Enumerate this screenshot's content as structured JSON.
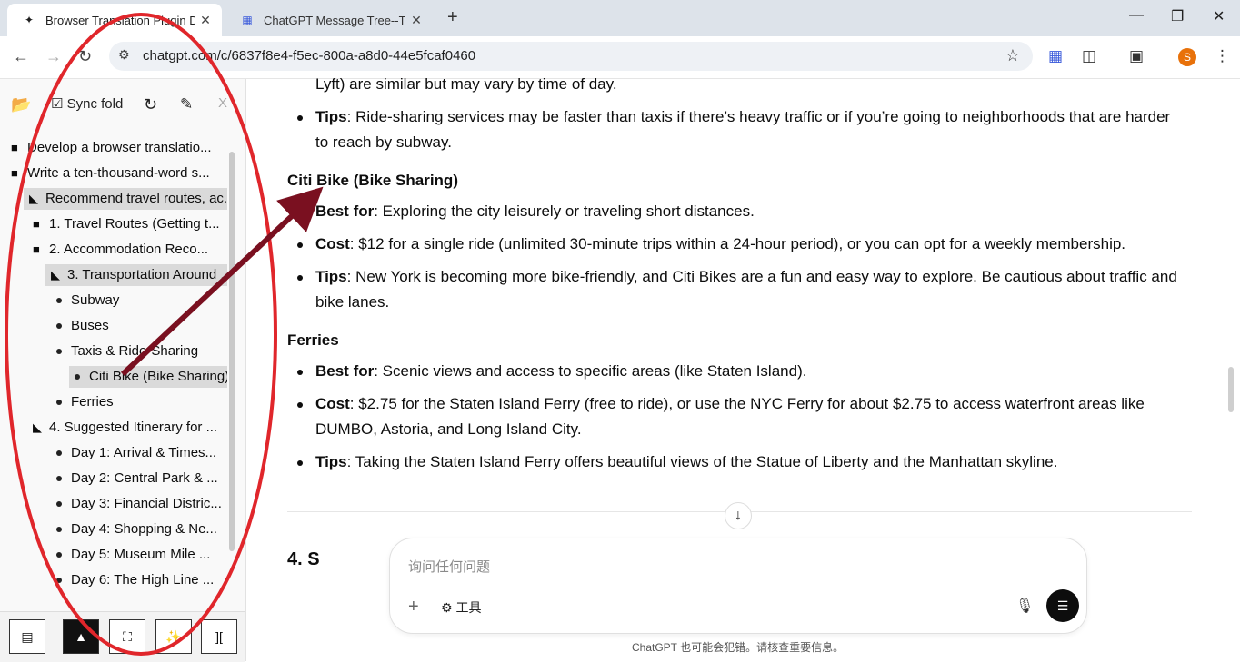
{
  "tabs": [
    {
      "title": "Browser Translation Plugin D",
      "favicon": "chatgpt-icon"
    },
    {
      "title": "ChatGPT Message Tree--Tree",
      "favicon": "tree-icon"
    }
  ],
  "address": {
    "url": "chatgpt.com/c/6837f8e4-f5ec-800a-a8d0-44e5fcaf0460",
    "avatar": "S"
  },
  "sidebar": {
    "toolbar": {
      "sync_fold": "Sync fold"
    },
    "tree": [
      {
        "label": "Develop a browser translatio...",
        "level": 0,
        "kind": "folder"
      },
      {
        "label": "Write a ten-thousand-word s...",
        "level": 0,
        "kind": "folder"
      },
      {
        "label": "Recommend travel routes, ac...",
        "level": 0,
        "kind": "folder-open",
        "selected": true
      },
      {
        "label": "1. Travel Routes (Getting t...",
        "level": 1,
        "kind": "folder"
      },
      {
        "label": "2. Accommodation Reco...",
        "level": 1,
        "kind": "folder"
      },
      {
        "label": "3. Transportation Around ...",
        "level": 1,
        "kind": "folder-open",
        "selected": true
      },
      {
        "label": "Subway",
        "level": 2,
        "kind": "leaf"
      },
      {
        "label": "Buses",
        "level": 2,
        "kind": "leaf"
      },
      {
        "label": "Taxis & Ride-Sharing",
        "level": 2,
        "kind": "leaf"
      },
      {
        "label": "Citi Bike (Bike Sharing)",
        "level": 2,
        "kind": "leaf",
        "selected": true
      },
      {
        "label": "Ferries",
        "level": 2,
        "kind": "leaf"
      },
      {
        "label": "4. Suggested Itinerary for ...",
        "level": 1,
        "kind": "folder-open"
      },
      {
        "label": "Day 1: Arrival & Times...",
        "level": 2,
        "kind": "leaf"
      },
      {
        "label": "Day 2: Central Park & ...",
        "level": 2,
        "kind": "leaf"
      },
      {
        "label": "Day 3: Financial Distric...",
        "level": 2,
        "kind": "leaf"
      },
      {
        "label": "Day 4: Shopping & Ne...",
        "level": 2,
        "kind": "leaf"
      },
      {
        "label": "Day 5: Museum Mile ...",
        "level": 2,
        "kind": "leaf"
      },
      {
        "label": "Day 6: The High Line ...",
        "level": 2,
        "kind": "leaf"
      }
    ],
    "bottom_buttons": [
      "layout-icon",
      "pdf-icon",
      "fullscreen-icon",
      "clean-icon",
      "bracket-icon"
    ]
  },
  "content": {
    "top_line": "Lyft) are similar but may vary by time of day.",
    "tips1_label": "Tips",
    "tips1_text": ": Ride-sharing services may be faster than taxis if there’s heavy traffic or if you’re going to neighborhoods that are harder",
    "tips1_cont": "to reach by subway.",
    "citi_heading": "Citi Bike (Bike Sharing)",
    "citi_best_label": "Best for",
    "citi_best_text": ": Exploring the city leisurely or traveling short distances.",
    "citi_cost_label": "Cost",
    "citi_cost_text": ": $12 for a single ride (unlimited 30-minute trips within a 24-hour period), or you can opt for a weekly membership.",
    "citi_tips_label": "Tips",
    "citi_tips_text": ": New York is becoming more bike-friendly, and Citi Bikes are a fun and easy way to explore. Be cautious about traffic and",
    "citi_tips_cont": "bike lanes.",
    "ferries_heading": "Ferries",
    "fer_best_label": "Best for",
    "fer_best_text": ": Scenic views and access to specific areas (like Staten Island).",
    "fer_cost_label": "Cost",
    "fer_cost_text": ": $2.75 for the Staten Island Ferry (free to ride), or use the NYC Ferry for about $2.75 to access waterfront areas like",
    "fer_cost_cont": "DUMBO, Astoria, and Long Island City.",
    "fer_tips_label": "Tips",
    "fer_tips_text": ": Taking the Staten Island Ferry offers beautiful views of the Statue of Liberty and the Manhattan skyline.",
    "next_heading_peek": "4. S"
  },
  "composer": {
    "placeholder": "询问任何问题",
    "tools_label": "工具"
  },
  "disclaimer": "ChatGPT 也可能会犯错。请核查重要信息。",
  "colors": {
    "annotation": "#e0262b",
    "arrow": "#7a1020",
    "selected_bg": "#dadada"
  }
}
